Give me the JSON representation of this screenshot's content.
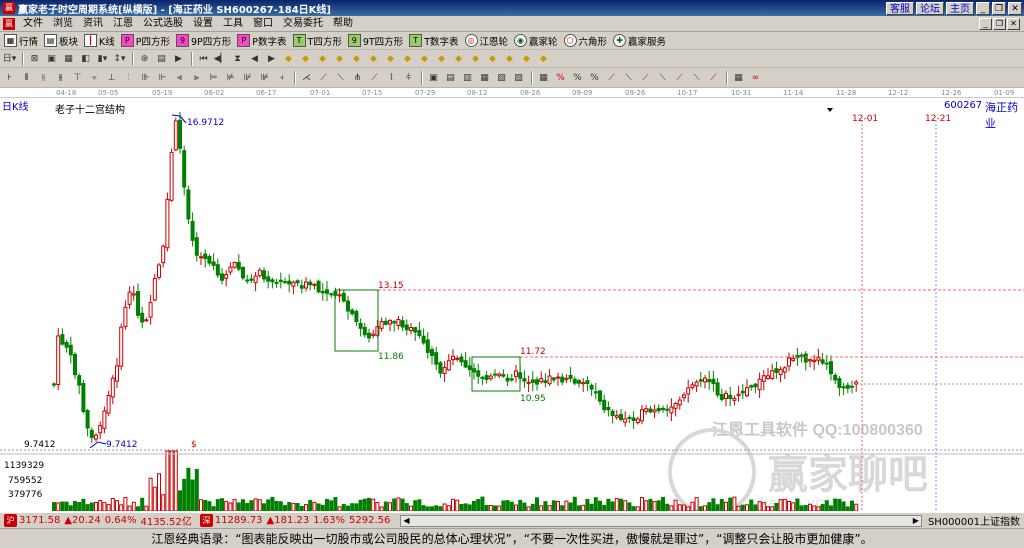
{
  "title_bar": {
    "app_title": "赢家老子时空周期系统[纵横版] - [海正药业 SH600267-184日K线]",
    "links": [
      "客服",
      "论坛",
      "主页"
    ]
  },
  "menu": {
    "items": [
      "文件",
      "浏览",
      "资讯",
      "江恩",
      "公式选股",
      "设置",
      "工具",
      "窗口",
      "交易委托",
      "帮助"
    ]
  },
  "toolbar1": {
    "items": [
      "行情",
      "板块",
      "K线",
      "P四方形",
      "9P四方形",
      "P数字表",
      "T四方形",
      "9T四方形",
      "T数字表",
      "江恩轮",
      "赢家轮",
      "六角形",
      "赢家服务"
    ]
  },
  "chart": {
    "period": "日K线",
    "title": "老子十二宫结构",
    "stock_code": "600267",
    "stock_name": "海正药业",
    "date_ticks": [
      "04-18",
      "05-05",
      "05-19",
      "06-02",
      "06-17",
      "07-01",
      "07-15",
      "07-29",
      "08-12",
      "08-26",
      "09-09",
      "09-26",
      "10-17",
      "10-31",
      "11-14",
      "11-28",
      "12-12",
      "12-26",
      "01-09"
    ],
    "future_dates": [
      "12-01",
      "12-21"
    ],
    "price_labels": {
      "high": "16.9712",
      "low": "9.7412",
      "low_axis": "9.7412",
      "box1_top": "13.15",
      "box1_bottom": "11.86",
      "box2_top": "11.72",
      "box2_bottom": "10.95"
    },
    "volume_axis": [
      "1139329",
      "759552",
      "379776"
    ],
    "dollar_mark": "$",
    "watermark_line1": "江恩工具软件 QQ:100800360",
    "watermark_line2": "赢家聊吧",
    "watermark_line3": "liaoba.yjzk..."
  },
  "status_bar": {
    "sh_index": "3171.58",
    "sh_change": "▲20.24",
    "sh_pct": "0.64%",
    "sh_amount": "4135.52亿",
    "sz_index": "11289.73",
    "sz_change": "▲181.23",
    "sz_pct": "1.63%",
    "sz_amount": "5292.56",
    "index_label": "SH000001上证指数"
  },
  "bottom_bar": {
    "text": "江恩经典语录：“图表能反映出一切股市或公司股民的总体心理状况”，“不要一次性买进，傲慢就是罪过”，“调整只会让股市更加健康”。"
  },
  "colors": {
    "up": "#cc0000",
    "down": "#008000",
    "guide": "#ff6666",
    "blue_label": "#0000cc"
  }
}
